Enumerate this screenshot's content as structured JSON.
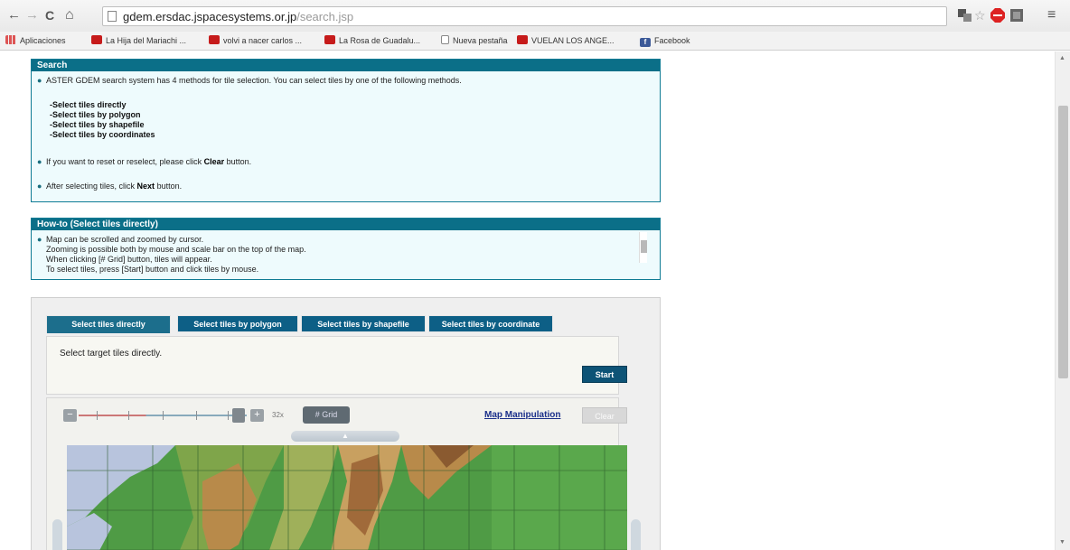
{
  "browser": {
    "url_host": "gdem.ersdac.jspacesystems.or.jp",
    "url_path": "/search.jsp",
    "bookmarks": [
      {
        "label": "Aplicaciones",
        "icon": "apps-icon"
      },
      {
        "label": "La Hija del Mariachi ...",
        "icon": "youtube-icon"
      },
      {
        "label": "volvi a nacer carlos ...",
        "icon": "youtube-icon"
      },
      {
        "label": "La Rosa de Guadalu...",
        "icon": "youtube-icon"
      },
      {
        "label": "Nueva pestaña",
        "icon": "page-icon"
      },
      {
        "label": "VUELAN LOS ANGE...",
        "icon": "youtube-icon"
      },
      {
        "label": "Facebook",
        "icon": "facebook-icon"
      }
    ]
  },
  "search_panel": {
    "title": "Search",
    "intro": "ASTER GDEM search system has 4 methods for tile selection. You can select tiles by one of the following methods.",
    "methods": [
      "Select tiles directly",
      "Select tiles by polygon",
      "Select tiles by shapefile",
      "Select tiles by coordinates"
    ],
    "reset_prefix": "If you want to reset or reselect, please click ",
    "reset_bold": "Clear",
    "reset_suffix": " button.",
    "next_prefix": "After selecting tiles, click ",
    "next_bold": "Next",
    "next_suffix": " button."
  },
  "howto_panel": {
    "title": "How-to (Select tiles directly)",
    "lines": [
      "Map can be scrolled and zoomed by cursor.",
      "Zooming is possible both by mouse and scale bar on the top of the map.",
      "When clicking [# Grid] button, tiles will appear.",
      "To select tiles, press [Start] button and click tiles by mouse."
    ]
  },
  "map_panel": {
    "tabs": [
      "Select tiles directly",
      "Select tiles by polygon",
      "Select tiles by shapefile",
      "Select tiles by coordinate"
    ],
    "active_tab": 0,
    "description": "Select target tiles directly.",
    "start_label": "Start",
    "scale_label": "32x",
    "grid_label": "# Grid",
    "map_manipulation_label": "Map Manipulation",
    "clear_label": "Clear",
    "collapse_symbol": "▲"
  },
  "icons": {
    "back": "←",
    "forward": "→",
    "reload": "C",
    "home": "⌂",
    "menu": "≡"
  },
  "colors": {
    "panel_header": "#0b6f88",
    "panel_bg": "#eefbfd",
    "tab_bg": "#0d5f86",
    "start_btn": "#0d5376",
    "map_link": "#1a2f8a"
  }
}
